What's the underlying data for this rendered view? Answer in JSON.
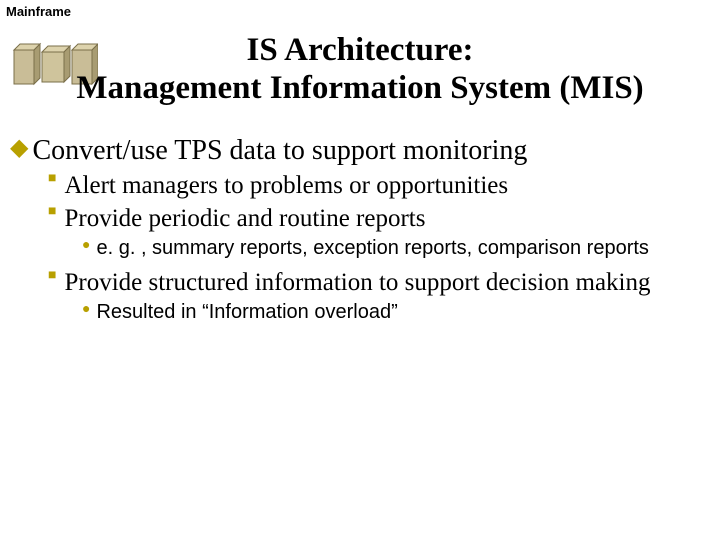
{
  "labelTop": "Mainframe",
  "title_line1": "IS Architecture:",
  "title_line2": "Management Information System (MIS)",
  "l1_1": "Convert/use TPS data to support monitoring",
  "l2_1": "Alert managers to problems or opportunities",
  "l2_2": "Provide periodic and routine reports",
  "l3_1": "e. g. , summary reports, exception reports, comparison reports",
  "l2_3": "Provide structured information to support decision making",
  "l3_2": "Resulted in “Information overload”"
}
